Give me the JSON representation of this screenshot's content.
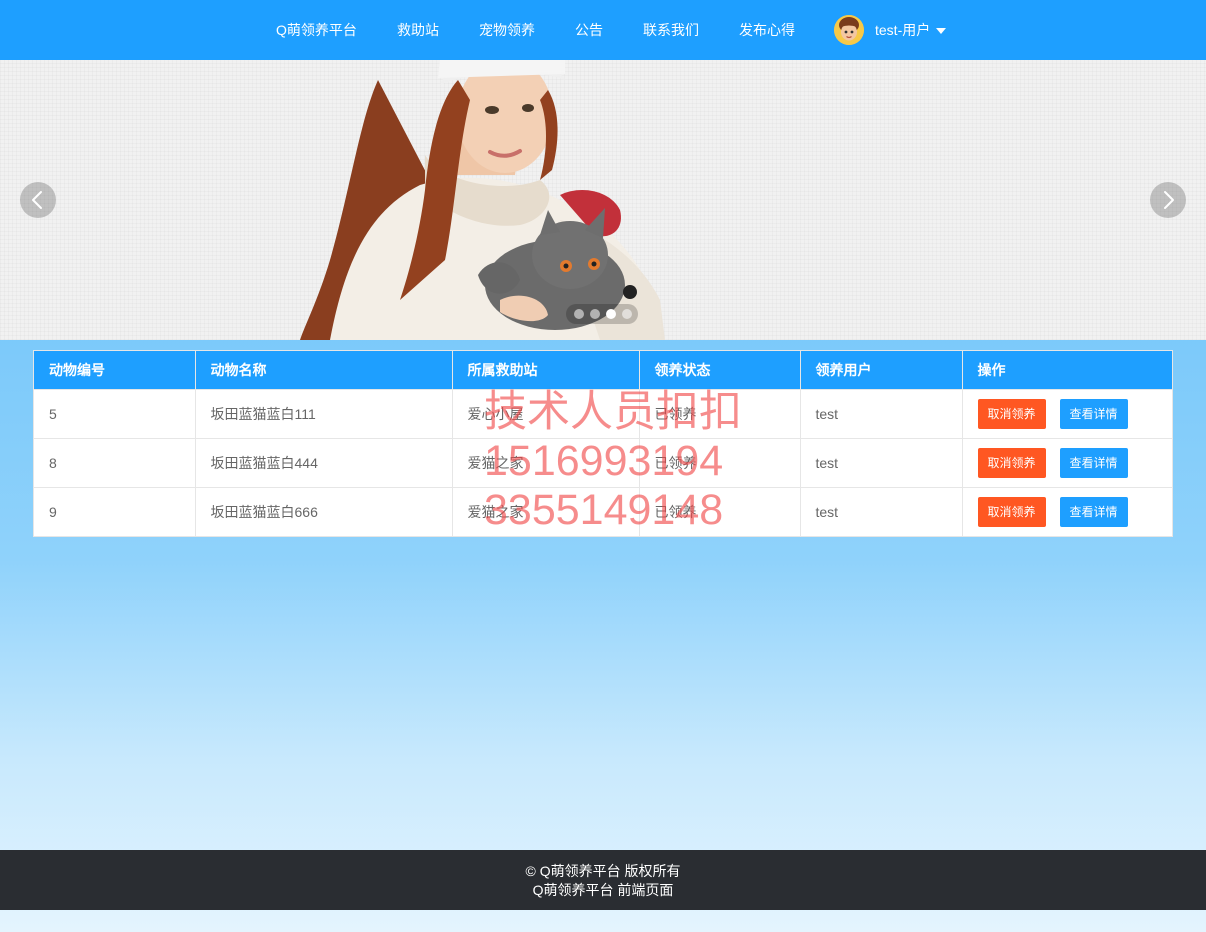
{
  "nav": {
    "items": [
      {
        "label": "Q萌领养平台"
      },
      {
        "label": "救助站"
      },
      {
        "label": "宠物领养"
      },
      {
        "label": "公告"
      },
      {
        "label": "联系我们"
      },
      {
        "label": "发布心得"
      }
    ],
    "user": {
      "name": "test-用户"
    }
  },
  "carousel": {
    "slide_count": 4,
    "active_slide": 3
  },
  "table": {
    "columns": [
      "动物编号",
      "动物名称",
      "所属救助站",
      "领养状态",
      "领养用户",
      "操作"
    ],
    "rows": [
      {
        "id": "5",
        "name": "坂田蓝猫蓝白111",
        "station": "爱心小屋",
        "status": "已领养",
        "user": "test"
      },
      {
        "id": "8",
        "name": "坂田蓝猫蓝白444",
        "station": "爱猫之家",
        "status": "已领养",
        "user": "test"
      },
      {
        "id": "9",
        "name": "坂田蓝猫蓝白666",
        "station": "爱猫之家",
        "status": "已领养",
        "user": "test"
      }
    ],
    "actions": {
      "cancel_label": "取消领养",
      "detail_label": "查看详情"
    }
  },
  "watermark": {
    "lines": [
      "技术人员扣扣",
      "1516993194",
      "3355149148"
    ]
  },
  "footer": {
    "line1": "© Q萌领养平台 版权所有",
    "line2": "Q萌领养平台 前端页面"
  },
  "colors": {
    "primary": "#1e9fff",
    "danger": "#ff5722",
    "footer_bg": "#2a2d32"
  }
}
